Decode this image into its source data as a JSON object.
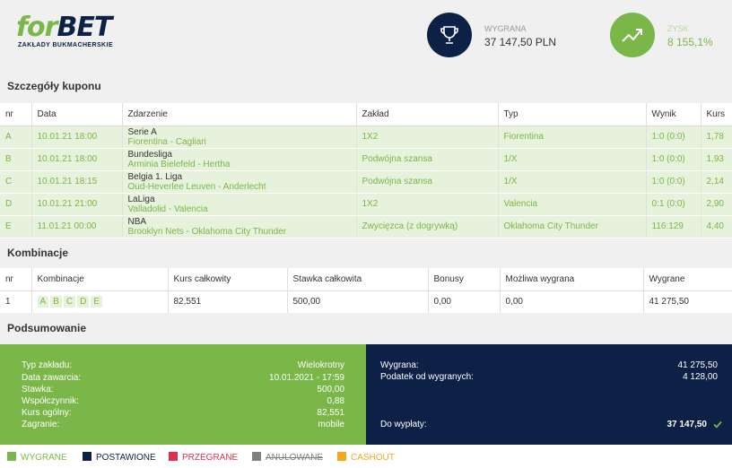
{
  "brand": {
    "name_for": "for",
    "name_bet": "BET",
    "subtitle": "ZAKŁADY BUKMACHERSKIE"
  },
  "stats": {
    "win": {
      "label": "WYGRANA",
      "value": "37 147,50 PLN",
      "icon": "trophy-icon"
    },
    "profit": {
      "label": "ZYSK",
      "value": "8 155,1%",
      "icon": "trend-up-icon"
    }
  },
  "sections": {
    "details": "Szczegóły kuponu",
    "combos": "Kombinacje",
    "summary": "Podsumowanie"
  },
  "bets_table": {
    "headers": [
      "nr",
      "Data",
      "Zdarzenie",
      "Zakład",
      "Typ",
      "Wynik",
      "Kurs"
    ],
    "rows": [
      {
        "nr": "A",
        "date": "10.01.21 18:00",
        "league": "Serie A",
        "teams": "Fiorentina - Cagliari",
        "bet": "1X2",
        "type": "Fiorentina",
        "result": "1:0 (0:0)",
        "odds": "1,78"
      },
      {
        "nr": "B",
        "date": "10.01.21 18:00",
        "league": "Bundesliga",
        "teams": "Arminia Bielefeld - Hertha",
        "bet": "Podwójna szansa",
        "type": "1/X",
        "result": "1:0 (0:0)",
        "odds": "1,93"
      },
      {
        "nr": "C",
        "date": "10.01.21 18:15",
        "league": "Belgia 1. Liga",
        "teams": "Oud-Heverlee Leuven - Anderlecht",
        "bet": "Podwójna szansa",
        "type": "1/X",
        "result": "1:0 (0:0)",
        "odds": "2,14"
      },
      {
        "nr": "D",
        "date": "10.01.21 21:00",
        "league": "LaLiga",
        "teams": "Valladolid - Valencia",
        "bet": "1X2",
        "type": "Valencia",
        "result": "0:1 (0:0)",
        "odds": "2,90"
      },
      {
        "nr": "E",
        "date": "11.01.21 00:00",
        "league": "NBA",
        "teams": "Brooklyn Nets - Oklahoma City Thunder",
        "bet": "Zwycięzca (z dogrywką)",
        "type": "Oklahoma City Thunder",
        "result": "116:129",
        "odds": "4,40"
      }
    ]
  },
  "combos_table": {
    "headers": [
      "nr",
      "Kombinacje",
      "Kurs całkowity",
      "Stawka całkowita",
      "Bonusy",
      "Możliwa wygrana",
      "Wygrane"
    ],
    "rows": [
      {
        "nr": "1",
        "letters": [
          "A",
          "B",
          "C",
          "D",
          "E"
        ],
        "total_odds": "82,551",
        "total_stake": "500,00",
        "bonus": "0,00",
        "possible_win": "0,00",
        "won": "41 275,50"
      }
    ]
  },
  "summary_left": [
    {
      "label": "Typ zakładu:",
      "value": "Wielokrotny"
    },
    {
      "label": "Data zawarcia:",
      "value": "10.01.2021 - 17:59"
    },
    {
      "label": "Stawka:",
      "value": "500,00"
    },
    {
      "label": "Współczynnik:",
      "value": "0,88"
    },
    {
      "label": "Kurs ogólny:",
      "value": "82,551"
    },
    {
      "label": "Zagranie:",
      "value": "mobile"
    }
  ],
  "summary_right": [
    {
      "label": "Wygrana:",
      "value": "41 275,50"
    },
    {
      "label": "Podatek od wygranych:",
      "value": "4 128,00"
    }
  ],
  "payout": {
    "label": "Do wypłaty:",
    "value": "37 147,50",
    "icon": "check-icon"
  },
  "legend": [
    {
      "label": "WYGRANE",
      "color": "#7ab648"
    },
    {
      "label": "POSTAWIONE",
      "color": "#0d2146"
    },
    {
      "label": "PRZEGRANE",
      "color": "#d9334b"
    },
    {
      "label": "ANULOWANE",
      "color": "#808080"
    },
    {
      "label": "CASHOUT",
      "color": "#f5a623"
    }
  ]
}
